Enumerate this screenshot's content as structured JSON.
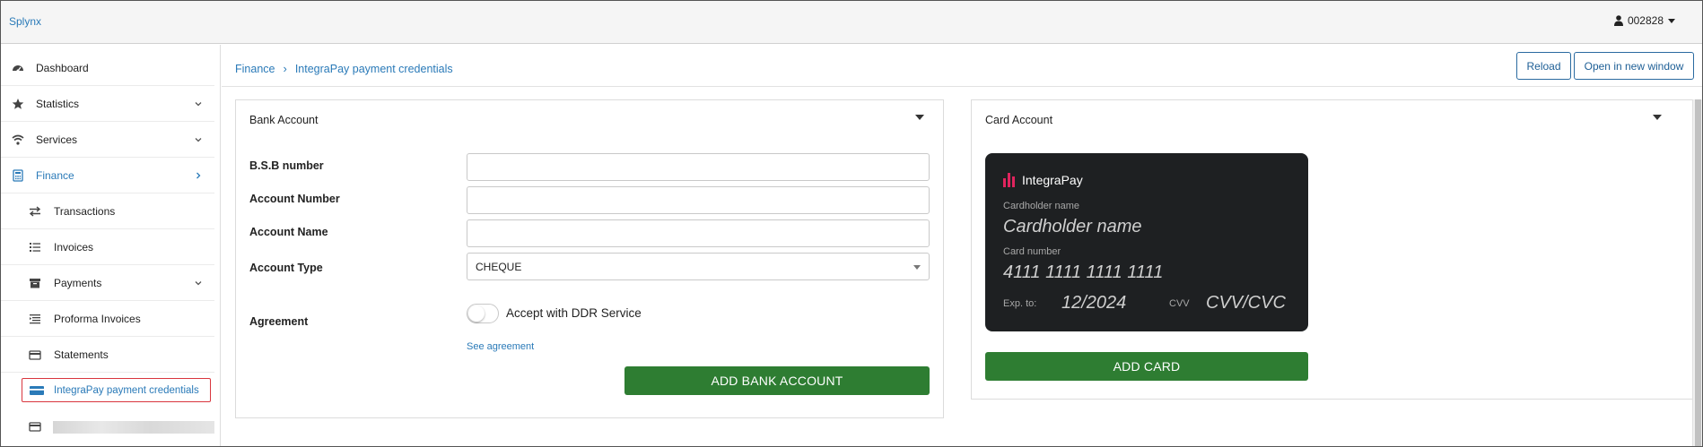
{
  "topbar": {
    "brand": "Splynx",
    "user": "002828"
  },
  "sidebar": {
    "items": [
      {
        "label": "Dashboard",
        "icon": "dashboard-icon"
      },
      {
        "label": "Statistics",
        "icon": "star-icon"
      },
      {
        "label": "Services",
        "icon": "wifi-icon"
      },
      {
        "label": "Finance",
        "icon": "calculator-icon"
      },
      {
        "label": "Transactions",
        "icon": "exchange-icon"
      },
      {
        "label": "Invoices",
        "icon": "list-icon"
      },
      {
        "label": "Payments",
        "icon": "archive-icon"
      },
      {
        "label": "Proforma Invoices",
        "icon": "indent-list-icon"
      },
      {
        "label": "Statements",
        "icon": "credit-card-icon"
      },
      {
        "label": "IntegraPay payment credentials",
        "icon": "credit-card-icon"
      }
    ]
  },
  "breadcrumb": {
    "root": "Finance",
    "current": "IntegraPay payment credentials"
  },
  "header": {
    "reload": "Reload",
    "open_new_window": "Open in new window"
  },
  "bank": {
    "title": "Bank Account",
    "bsb_label": "B.S.B number",
    "bsb_value": "",
    "account_number_label": "Account Number",
    "account_number_value": "",
    "account_name_label": "Account Name",
    "account_name_value": "",
    "account_type_label": "Account Type",
    "account_type_value": "CHEQUE",
    "agreement_label": "Agreement",
    "ddr_label": "Accept with DDR Service",
    "ddr_checked": false,
    "see_agreement": "See agreement",
    "add_button": "ADD BANK ACCOUNT"
  },
  "card": {
    "title": "Card Account",
    "brand": "IntegraPay",
    "cardholder_caption": "Cardholder name",
    "cardholder_value": "Cardholder name",
    "number_caption": "Card number",
    "number_value": "4111 1111 1111 1111",
    "exp_caption": "Exp. to:",
    "exp_value": "12/2024",
    "cvv_caption": "CVV",
    "cvv_value": "CVV/CVC",
    "add_button": "ADD CARD"
  },
  "colors": {
    "link": "#2a7ab8",
    "accent_green": "#2e7d32",
    "card_bg": "#1e2022",
    "logo_pink": "#e0245e",
    "highlight": "#d9363e"
  }
}
